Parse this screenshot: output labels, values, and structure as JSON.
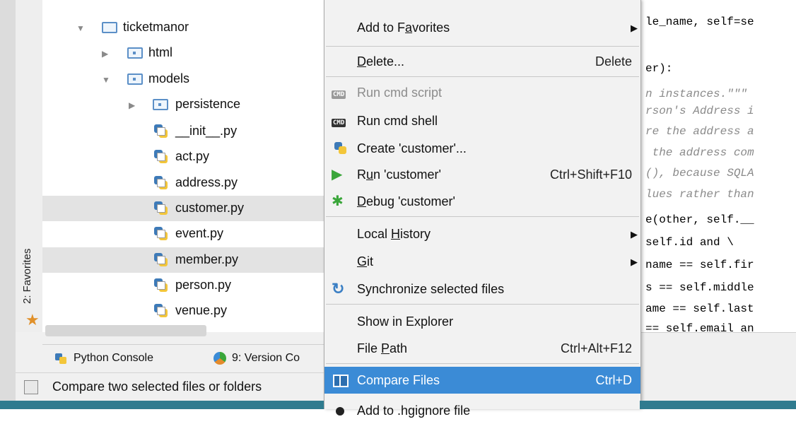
{
  "favorites_strip": {
    "label": "2: Favorites"
  },
  "tree": {
    "items": [
      {
        "label": "ticketmanor",
        "kind": "folder",
        "expanded": true,
        "level": 0
      },
      {
        "label": "html",
        "kind": "package",
        "expanded": false,
        "level": 1
      },
      {
        "label": "models",
        "kind": "package",
        "expanded": true,
        "level": 1
      },
      {
        "label": "persistence",
        "kind": "package",
        "expanded": false,
        "level": 2
      },
      {
        "label": "__init__.py",
        "kind": "py",
        "level": 2
      },
      {
        "label": "act.py",
        "kind": "py",
        "level": 2
      },
      {
        "label": "address.py",
        "kind": "py",
        "level": 2
      },
      {
        "label": "customer.py",
        "kind": "py",
        "level": 2,
        "selected": true
      },
      {
        "label": "event.py",
        "kind": "py",
        "level": 2
      },
      {
        "label": "member.py",
        "kind": "py",
        "level": 2,
        "selected": true
      },
      {
        "label": "person.py",
        "kind": "py",
        "level": 2
      },
      {
        "label": "venue.py",
        "kind": "py",
        "level": 2
      }
    ]
  },
  "bottom_bar": {
    "python_console": "Python Console",
    "version_control": "9: Version Co"
  },
  "status": {
    "text": "Compare two selected files or folders"
  },
  "menu": {
    "add_favorites": {
      "pre": "Add to F",
      "u": "a",
      "post": "vorites"
    },
    "delete": {
      "pre": "",
      "u": "D",
      "post": "elete...",
      "shortcut": "Delete"
    },
    "run_cmd_script": {
      "label": "Run cmd script"
    },
    "run_cmd_shell": {
      "label": "Run cmd shell"
    },
    "create_customer": {
      "label": "Create 'customer'..."
    },
    "run_customer": {
      "pre": "R",
      "u": "u",
      "post": "n 'customer'",
      "shortcut": "Ctrl+Shift+F10"
    },
    "debug_customer": {
      "pre": "",
      "u": "D",
      "post": "ebug 'customer'"
    },
    "local_history": {
      "pre": "Local ",
      "u": "H",
      "post": "istory"
    },
    "git": {
      "pre": "",
      "u": "G",
      "post": "it"
    },
    "synchronize": {
      "label": "Synchronize selected files"
    },
    "show_in_explorer": {
      "label": "Show in Explorer"
    },
    "file_path": {
      "pre": "File ",
      "u": "P",
      "post": "ath",
      "shortcut": "Ctrl+Alt+F12"
    },
    "compare_files": {
      "label": "Compare Files",
      "shortcut": "Ctrl+D"
    },
    "add_to_ignore": {
      "label": "Add to .hgignore file"
    }
  },
  "editor": {
    "lines": [
      {
        "text": "le_name, self=se",
        "style": "plain"
      },
      {
        "text": "er):",
        "style": "plain"
      },
      {
        "text": "n instances.\"\"\"",
        "style": "it"
      },
      {
        "text": "rson's Address i",
        "style": "it"
      },
      {
        "text": "re the address a",
        "style": "it"
      },
      {
        "text": " the address com",
        "style": "it"
      },
      {
        "text": "(), because SQLA",
        "style": "it"
      },
      {
        "text": "lues rather than",
        "style": "it"
      },
      {
        "text": "e(other, self.__",
        "style": "plain"
      },
      {
        "text": "self.id and \\",
        "style": "plain"
      },
      {
        "text": "name == self.fir",
        "style": "plain"
      },
      {
        "text": "s == self.middle",
        "style": "plain"
      },
      {
        "text": "ame == self.last",
        "style": "plain"
      },
      {
        "text": "== self.email an",
        "style": "plain"
      }
    ]
  },
  "colors": {
    "selection": "#3b8bd6",
    "folder": "#5b8fc7",
    "run_green": "#3aa63a",
    "star": "#e0902a",
    "status_strip": "#2f7b8f"
  }
}
